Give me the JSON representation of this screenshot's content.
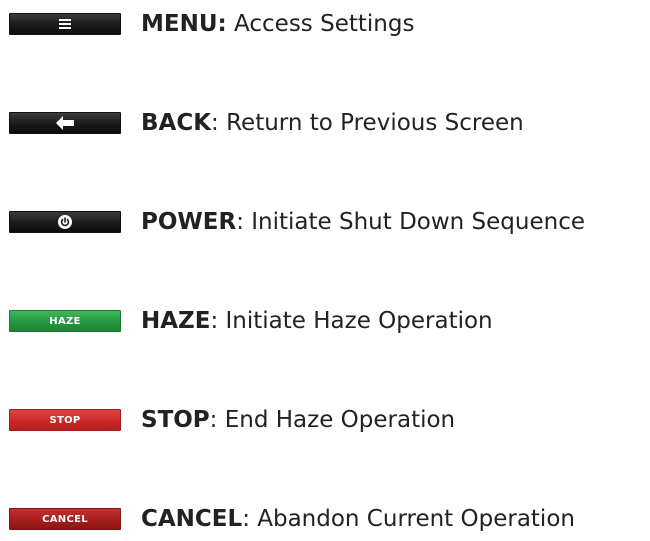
{
  "items": [
    {
      "key": "MENU:",
      "desc": " Access Settings",
      "button_label": "",
      "icon": "hamburger-menu-icon",
      "button_color": "#1a1a1a"
    },
    {
      "key": "BACK",
      "desc": ": Return to Previous Screen",
      "button_label": "",
      "icon": "left-arrow-icon",
      "button_color": "#1a1a1a"
    },
    {
      "key": "POWER",
      "desc": ": Initiate Shut Down Sequence",
      "button_label": "",
      "icon": "power-icon",
      "button_color": "#1a1a1a"
    },
    {
      "key": "HAZE",
      "desc": ": Initiate Haze Operation",
      "button_label": "HAZE",
      "icon": "",
      "button_color": "#23953c"
    },
    {
      "key": "STOP",
      "desc": ": End Haze Operation",
      "button_label": "STOP",
      "icon": "",
      "button_color": "#c72626"
    },
    {
      "key": "CANCEL",
      "desc": ": Abandon Current Operation",
      "button_label": "CANCEL",
      "icon": "",
      "button_color": "#a31c1c"
    }
  ]
}
